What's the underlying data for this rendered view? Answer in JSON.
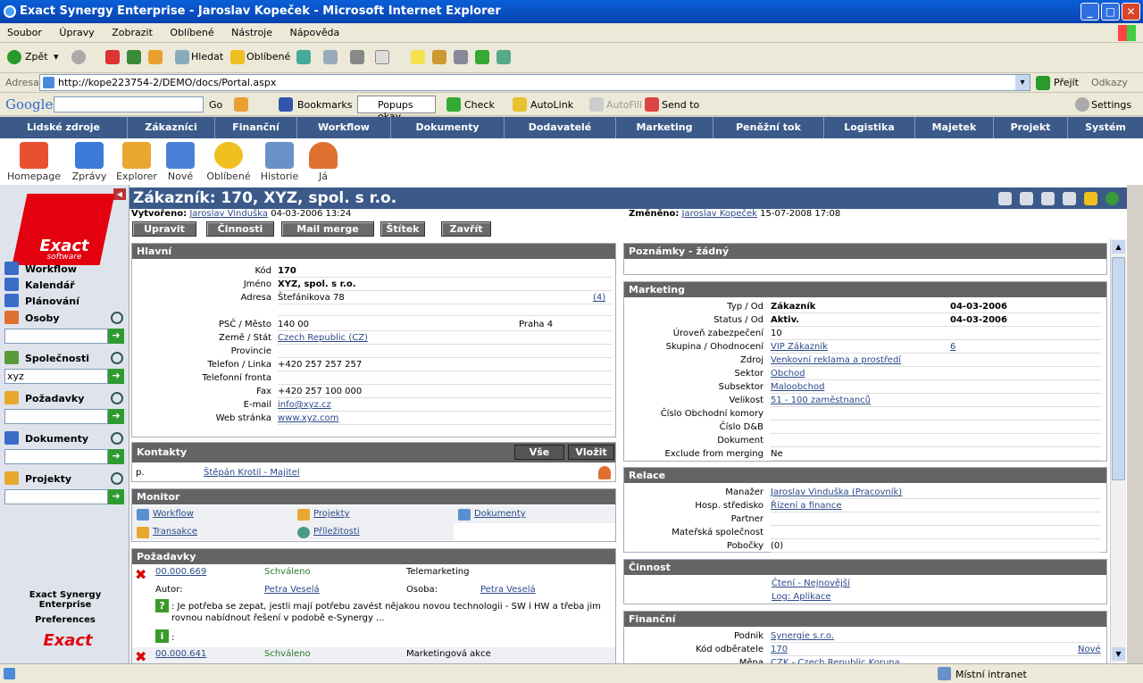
{
  "window": {
    "title": "Exact Synergy Enterprise - Jaroslav Kopeček - Microsoft Internet Explorer"
  },
  "menu": [
    "Soubor",
    "Úpravy",
    "Zobrazit",
    "Oblíbené",
    "Nástroje",
    "Nápověda"
  ],
  "toolbar": {
    "back": "Zpět",
    "search": "Hledat",
    "favorites": "Oblíbené"
  },
  "address": {
    "label": "Adresa",
    "url": "http://kope223754-2/DEMO/docs/Portal.aspx",
    "go": "Přejít",
    "links": "Odkazy"
  },
  "google": {
    "logo": "Google",
    "go": "Go",
    "bookmarks": "Bookmarks",
    "popups": "Popups okay",
    "check": "Check",
    "autolink": "AutoLink",
    "autofill": "AutoFill",
    "sendto": "Send to",
    "settings": "Settings"
  },
  "nav": [
    "Lidské zdroje",
    "Zákazníci",
    "Finanční",
    "Workflow",
    "Dokumenty",
    "Dodavatelé",
    "Marketing",
    "Peněžní tok",
    "Logistika",
    "Majetek",
    "Projekt",
    "Systém"
  ],
  "icons": [
    "Homepage",
    "Zprávy",
    "Explorer",
    "Nové",
    "Oblíbené",
    "Historie",
    "Já"
  ],
  "sidebar": {
    "logo": "Exact",
    "logo_sub": "software",
    "items": [
      "Workflow",
      "Kalendář",
      "Plánování",
      "Osoby",
      "Společnosti",
      "Požadavky",
      "Dokumenty",
      "Projekty"
    ],
    "company_value": "xyz",
    "footer1": "Exact Synergy Enterprise",
    "footer2": "Preferences"
  },
  "page": {
    "title": "Zákazník: 170, XYZ, spol. s r.o.",
    "created_label": "Vytvořeno:",
    "created_by": "Jaroslav Vinduška",
    "created_at": "04-03-2006 13:24",
    "changed_label": "Změněno:",
    "changed_by": "Jaroslav Kopeček",
    "changed_at": "15-07-2008 17:08",
    "buttons": [
      "Upravit",
      "Činnosti",
      "Mail merge",
      "Štítek",
      "Zavřít"
    ]
  },
  "main": {
    "header": "Hlavní",
    "rows": [
      {
        "label": "Kód",
        "value": "170"
      },
      {
        "label": "Jméno",
        "value": "XYZ, spol. s r.o."
      },
      {
        "label": "Adresa",
        "value": "Štefánikova 78"
      },
      {
        "label": "PSČ / Město",
        "value": "140 00"
      },
      {
        "label": "Země / Stát",
        "value": "Czech Republic (CZ)"
      },
      {
        "label": "Provincie",
        "value": ""
      },
      {
        "label": "Telefon / Linka",
        "value": "+420 257 257 257"
      },
      {
        "label": "Telefonní fronta",
        "value": ""
      },
      {
        "label": "Fax",
        "value": "+420 257 100 000"
      },
      {
        "label": "E-mail",
        "value": "info@xyz.cz"
      },
      {
        "label": "Web stránka",
        "value": "www.xyz.com"
      }
    ],
    "address_count": "(4)",
    "city": "Praha 4"
  },
  "contacts": {
    "header": "Kontakty",
    "btn_all": "Vše",
    "btn_insert": "Vložit",
    "prefix": "p.",
    "name": "Štěpán Krotil - Majitel"
  },
  "monitor": {
    "header": "Monitor",
    "items": [
      "Workflow",
      "Projekty",
      "Dokumenty",
      "Transakce",
      "Příležitosti"
    ]
  },
  "requests": {
    "header": "Požadavky",
    "r1_id": "00.000.669",
    "r1_status": "Schváleno",
    "r1_type": "Telemarketing",
    "author_label": "Autor:",
    "author": "Petra Veselá",
    "person_label": "Osoba:",
    "person": "Petra Veselá",
    "r1_text": ": Je potřeba se zepat, jestli mají potřebu zavést nějakou novou technologii - SW i HW a třeba jim rovnou nabídnout řešení v podobě e-Synergy ...",
    "r1_info": ":",
    "r2_id": "00.000.641",
    "r2_status": "Schváleno",
    "r2_type": "Marketingová akce"
  },
  "notes": {
    "header": "Poznámky - žádný"
  },
  "marketing": {
    "header": "Marketing",
    "rows": [
      {
        "label": "Typ / Od",
        "value": "Zákazník",
        "date": "04-03-2006"
      },
      {
        "label": "Status / Od",
        "value": "Aktiv.",
        "date": "04-03-2006"
      },
      {
        "label": "Úroveň zabezpečení",
        "value": "10"
      },
      {
        "label": "Skupina / Ohodnocení",
        "value": "VIP Zákazník",
        "extra": "6"
      },
      {
        "label": "Zdroj",
        "value": "Venkovní reklama a prostředí"
      },
      {
        "label": "Sektor",
        "value": "Obchod"
      },
      {
        "label": "Subsektor",
        "value": "Maloobchod"
      },
      {
        "label": "Velikost",
        "value": "51 - 100 zaměstnanců"
      },
      {
        "label": "Číslo Obchodní komory",
        "value": ""
      },
      {
        "label": "Číslo D&B",
        "value": ""
      },
      {
        "label": "Dokument",
        "value": ""
      },
      {
        "label": "Exclude from merging",
        "value": "Ne"
      }
    ]
  },
  "relations": {
    "header": "Relace",
    "rows": [
      {
        "label": "Manažer",
        "value": "Jaroslav Vinduška (Pracovník)"
      },
      {
        "label": "Hosp. středisko",
        "value": "Řízení a finance"
      },
      {
        "label": "Partner",
        "value": ""
      },
      {
        "label": "Mateřská společnost",
        "value": ""
      },
      {
        "label": "Pobočky",
        "value": "(0)"
      }
    ]
  },
  "activity": {
    "header": "Činnost",
    "a1": "Čtení - Nejnovější",
    "a2": "Log: Aplikace"
  },
  "finance": {
    "header": "Finanční",
    "rows": [
      {
        "label": "Podnik",
        "value": "Synergie s.r.o."
      },
      {
        "label": "Kód odběratele",
        "value": "170",
        "extra": "Nové"
      },
      {
        "label": "Měna",
        "value": "CZK - Czech Republic Koruna"
      }
    ]
  },
  "status": {
    "zone": "Místní intranet"
  }
}
